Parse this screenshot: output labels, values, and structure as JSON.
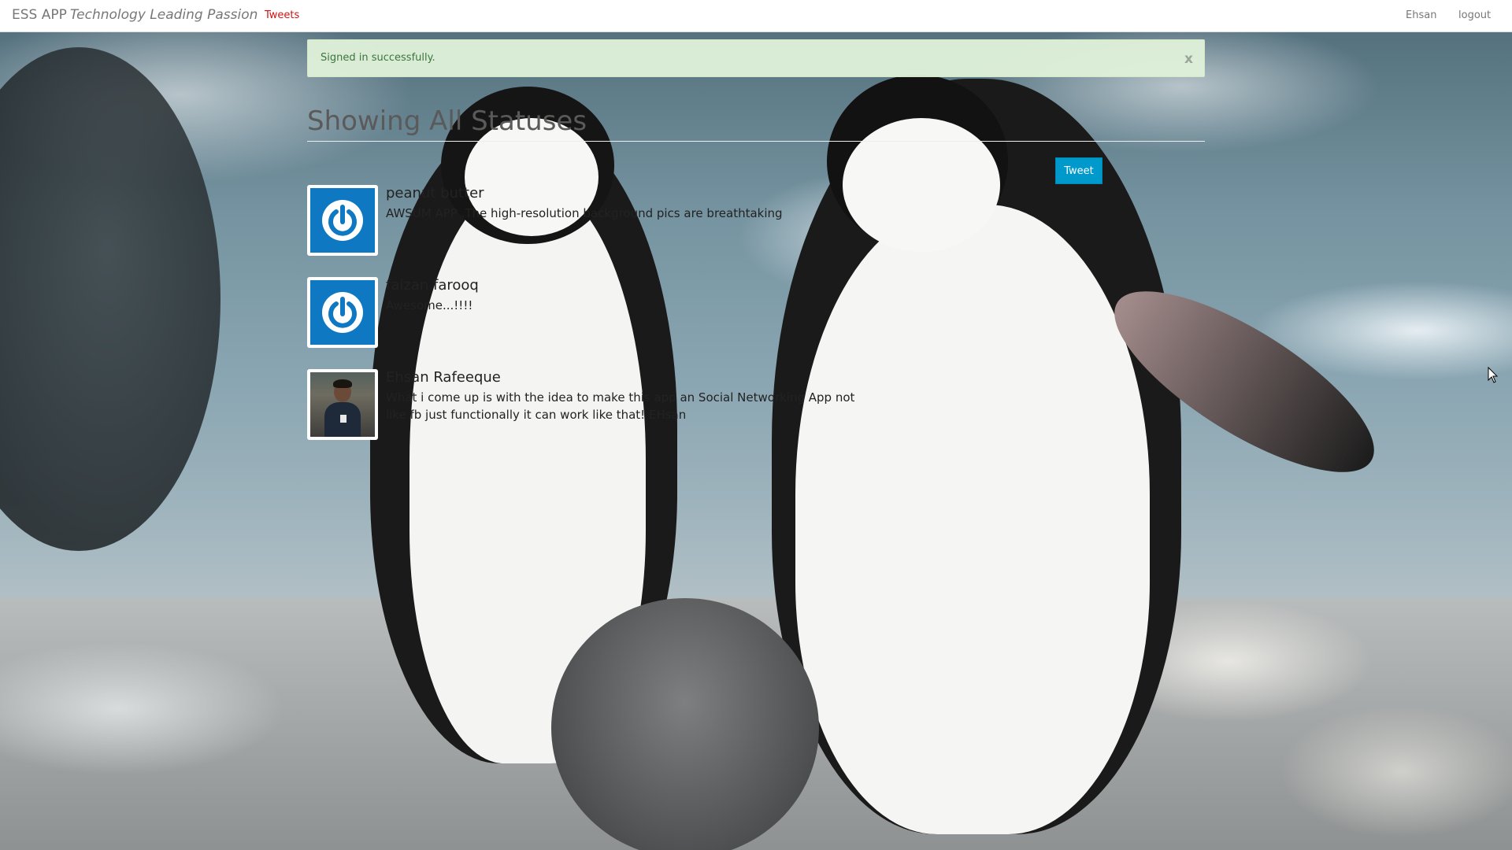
{
  "navbar": {
    "brand": "ESS APP",
    "tagline": "Technology Leading Passion",
    "links": {
      "tweets": "Tweets",
      "user": "Ehsan",
      "logout": "logout"
    }
  },
  "alert": {
    "message": "Signed in successfully.",
    "close": "x"
  },
  "page": {
    "title": "Showing All Statuses",
    "tweet_button": "Tweet"
  },
  "statuses": [
    {
      "name": "peanut butter",
      "text": "AWSUM APP .The high-resolution background pics are breathtaking",
      "avatar": "power-icon"
    },
    {
      "name": "faizan farooq",
      "text": "Awesome...!!!!",
      "avatar": "power-icon"
    },
    {
      "name": "Ehsan Rafeeque",
      "text": "What i come up is with the idea to make this app an Social Networking App not like fb just functionally it can work like that! EHsan",
      "avatar": "user-photo"
    }
  ],
  "colors": {
    "accent": "#0099cc",
    "nav_active": "#d11313",
    "alert_bg": "#dff0d8",
    "avatar_blue": "#0f78c2"
  }
}
